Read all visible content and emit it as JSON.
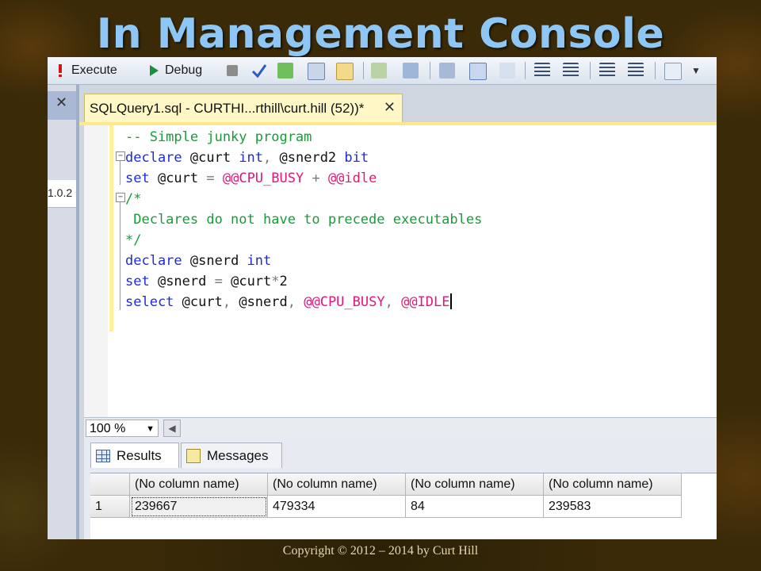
{
  "slide": {
    "title": "In Management Console",
    "copyright": "Copyright © 2012 – 2014 by Curt Hill"
  },
  "toolbar": {
    "execute_label": "Execute",
    "debug_label": "Debug",
    "icons": [
      "exclamation-icon",
      "play-icon",
      "stop-icon",
      "checkmark-icon",
      "parse-icon",
      "display-plan-icon",
      "query-options-icon",
      "results-to-icon",
      "results-grid-icon",
      "results-file-icon",
      "comment-icon",
      "uncomment-icon",
      "outdent-icon",
      "indent-icon",
      "specify-values-icon"
    ]
  },
  "left_pane": {
    "close_glyph": "✕",
    "fragment_text": "1.0.2"
  },
  "document_tab": {
    "label": "SQLQuery1.sql - CURTHI...rthill\\curt.hill (52))*",
    "close_glyph": "✕"
  },
  "editor": {
    "lines": [
      [
        {
          "t": "-- Simple junky program",
          "c": "cm"
        }
      ],
      [
        {
          "t": "declare ",
          "c": "kw"
        },
        {
          "t": "@curt ",
          "c": "pl"
        },
        {
          "t": "int",
          "c": "kw"
        },
        {
          "t": ", ",
          "c": "op"
        },
        {
          "t": "@snerd2 ",
          "c": "pl"
        },
        {
          "t": "bit",
          "c": "kw"
        }
      ],
      [
        {
          "t": "set ",
          "c": "kw"
        },
        {
          "t": "@curt ",
          "c": "pl"
        },
        {
          "t": "= ",
          "c": "op"
        },
        {
          "t": "@@CPU_BUSY ",
          "c": "gv"
        },
        {
          "t": "+ ",
          "c": "op"
        },
        {
          "t": "@@idle",
          "c": "gv"
        }
      ],
      [
        {
          "t": "/*",
          "c": "cm"
        }
      ],
      [
        {
          "t": " Declares do not have to precede executables",
          "c": "cm"
        }
      ],
      [
        {
          "t": "*/",
          "c": "cm"
        }
      ],
      [
        {
          "t": "declare ",
          "c": "kw"
        },
        {
          "t": "@snerd ",
          "c": "pl"
        },
        {
          "t": "int",
          "c": "kw"
        }
      ],
      [
        {
          "t": "set ",
          "c": "kw"
        },
        {
          "t": "@snerd ",
          "c": "pl"
        },
        {
          "t": "= ",
          "c": "op"
        },
        {
          "t": "@curt",
          "c": "pl"
        },
        {
          "t": "*",
          "c": "op"
        },
        {
          "t": "2",
          "c": "pl"
        }
      ],
      [
        {
          "t": "select ",
          "c": "kw"
        },
        {
          "t": "@curt",
          "c": "pl"
        },
        {
          "t": ", ",
          "c": "op"
        },
        {
          "t": "@snerd",
          "c": "pl"
        },
        {
          "t": ", ",
          "c": "op"
        },
        {
          "t": "@@CPU_BUSY",
          "c": "gv"
        },
        {
          "t": ", ",
          "c": "op"
        },
        {
          "t": "@@IDLE",
          "c": "gv"
        }
      ]
    ]
  },
  "status": {
    "zoom": "100 %",
    "zoom_arrow": "▼",
    "scroll_left": "◀"
  },
  "results": {
    "tabs": [
      {
        "label": "Results",
        "icon": "grid-icon"
      },
      {
        "label": "Messages",
        "icon": "messages-icon"
      }
    ],
    "columns": [
      "(No column name)",
      "(No column name)",
      "(No column name)",
      "(No column name)"
    ],
    "rows": [
      {
        "num": "1",
        "cells": [
          "239667",
          "479334",
          "84",
          "239583"
        ]
      }
    ]
  }
}
